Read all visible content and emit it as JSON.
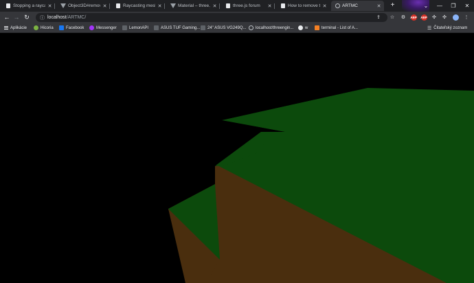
{
  "tabs": [
    {
      "title": "Stopping a raycast",
      "icon": "doc",
      "active": false
    },
    {
      "title": "Object3D#remove",
      "icon": "tri",
      "active": false
    },
    {
      "title": "Raycasting meshes",
      "icon": "doc",
      "active": false
    },
    {
      "title": "Material – three.js",
      "icon": "tri",
      "active": false
    },
    {
      "title": "three.js forum",
      "icon": "doc",
      "active": false
    },
    {
      "title": "How to remove th",
      "icon": "doc",
      "active": false
    },
    {
      "title": "ARTMC",
      "icon": "globe",
      "active": true
    }
  ],
  "address": {
    "host": "localhost",
    "path": "/ARTMC/"
  },
  "extensions": [
    {
      "label": "ABP",
      "color": "#d93025"
    },
    {
      "label": "ABP",
      "color": "#d93025"
    }
  ],
  "bookmarks": [
    {
      "label": "Aplikácie",
      "icon": "apps"
    },
    {
      "label": "Hicoria",
      "color": "#7cb342"
    },
    {
      "label": "Facebook",
      "color": "#1877f2"
    },
    {
      "label": "Messenger",
      "color": "#a334fa"
    },
    {
      "label": "LemonAPI",
      "color": "#5f6368"
    },
    {
      "label": "ASUS TUF Gaming...",
      "color": "#5f6368"
    },
    {
      "label": "24\" ASUS VG249Q...",
      "color": "#5f6368"
    },
    {
      "label": "localhost/threengin...",
      "color": "#bdc1c6"
    },
    {
      "label": "w",
      "color": "#e8eaed"
    },
    {
      "label": "terminal - List of A...",
      "color": "#f48024"
    }
  ],
  "reading_list": "Čitateľský zoznam",
  "scene": {
    "background": "#000000",
    "grass_color": "#0c4a0c",
    "dirt_color": "#4a2e0e"
  }
}
